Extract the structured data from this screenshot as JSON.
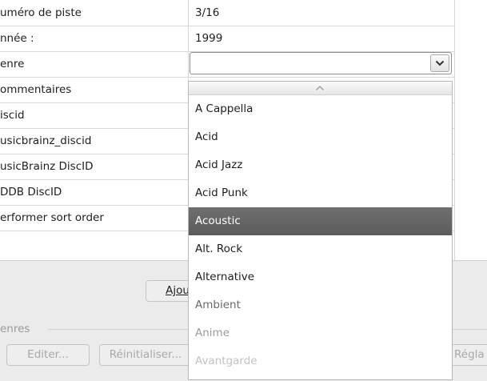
{
  "fields": [
    {
      "label": "uméro de piste",
      "value": "3/16"
    },
    {
      "label": "nnée :",
      "value": "1999"
    },
    {
      "label": "enre",
      "value": ""
    },
    {
      "label": "ommentaires",
      "value": ""
    },
    {
      "label": "iscid",
      "value": ""
    },
    {
      "label": "usicbrainz_discid",
      "value": ""
    },
    {
      "label": "usicBrainz DiscID",
      "value": ""
    },
    {
      "label": "DDB DiscID",
      "value": ""
    },
    {
      "label": "erformer sort order",
      "value": ""
    }
  ],
  "genre_combo": {
    "value": "",
    "icon": "chevron-down-icon"
  },
  "dropdown": {
    "scroll_up_icon": "chevron-up-icon",
    "items": [
      "A Cappella",
      "Acid",
      "Acid Jazz",
      "Acid Punk",
      "Acoustic",
      "Alt. Rock",
      "Alternative",
      "Ambient",
      "Anime",
      "Avantgarde"
    ],
    "selected": "Acoustic"
  },
  "bottom": {
    "add_button": "Ajou",
    "section_label": "enres",
    "edit_button": "Editer...",
    "reset_button": "Réinitialiser...",
    "settings_button": "Régla"
  }
}
